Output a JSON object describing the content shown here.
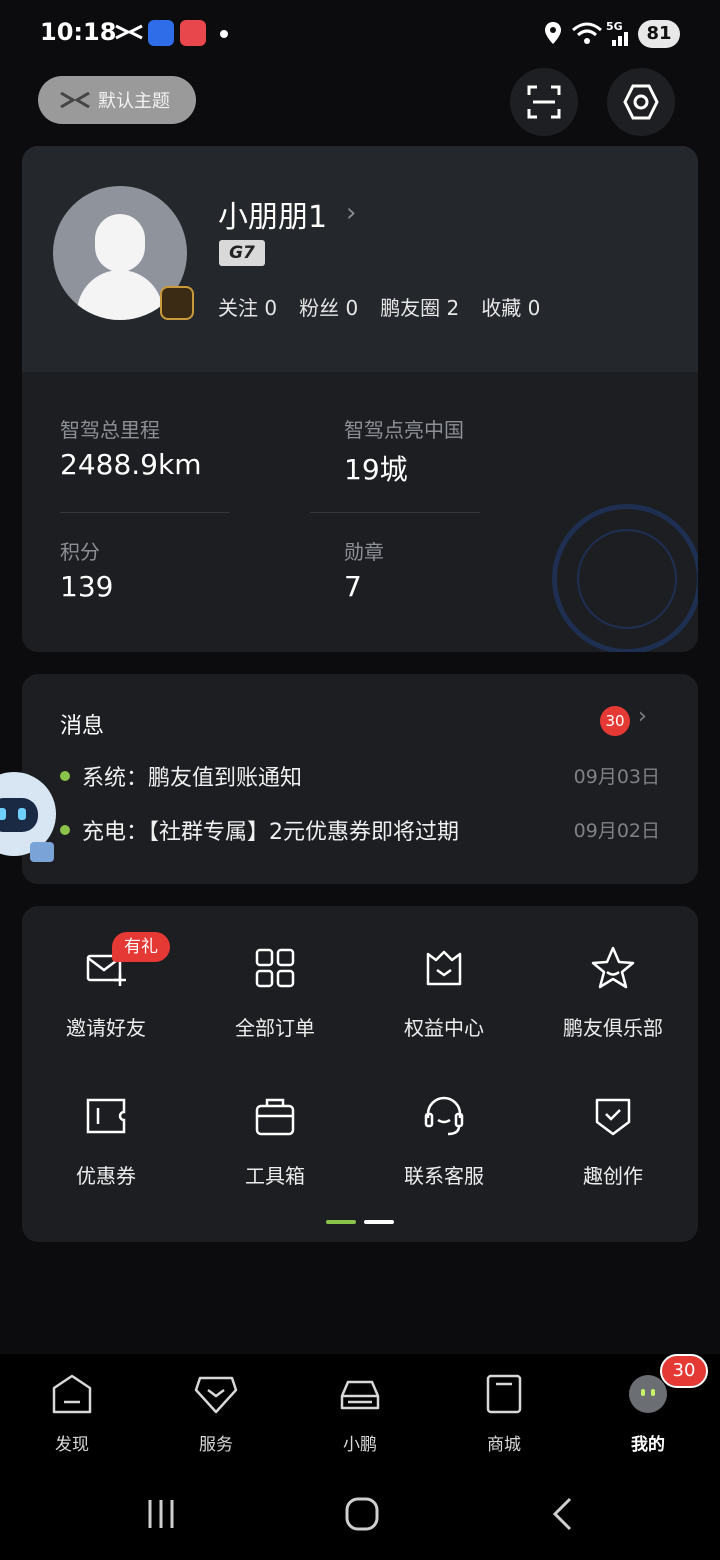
{
  "status_bar": {
    "time": "10:18",
    "battery": "81",
    "network": "5G"
  },
  "header": {
    "theme_label": "默认主题",
    "icons": [
      "scan-icon",
      "settings-icon"
    ]
  },
  "profile": {
    "username": "小朋朋1",
    "car_model": "G7",
    "social": [
      {
        "label": "关注",
        "value": "0"
      },
      {
        "label": "粉丝",
        "value": "0"
      },
      {
        "label": "鹏友圈",
        "value": "2"
      },
      {
        "label": "收藏",
        "value": "0"
      }
    ]
  },
  "stats": [
    {
      "label": "智驾总里程",
      "value": "2488.9km"
    },
    {
      "label": "智驾点亮中国",
      "value": "19城"
    },
    {
      "label": "积分",
      "value": "139"
    },
    {
      "label": "勋章",
      "value": "7"
    }
  ],
  "messages": {
    "title": "消息",
    "unread": "30",
    "items": [
      {
        "text": "系统：鹏友值到账通知",
        "date": "09月03日"
      },
      {
        "text": "充电：【社群专属】2元优惠券即将过期",
        "date": "09月02日"
      }
    ]
  },
  "services": {
    "gift_badge": "有礼",
    "items": [
      {
        "label": "邀请好友",
        "icon": "mail-plus-icon"
      },
      {
        "label": "全部订单",
        "icon": "grid-icon"
      },
      {
        "label": "权益中心",
        "icon": "crown-box-icon"
      },
      {
        "label": "鹏友俱乐部",
        "icon": "star-icon"
      },
      {
        "label": "优惠券",
        "icon": "coupon-icon"
      },
      {
        "label": "工具箱",
        "icon": "toolbox-icon"
      },
      {
        "label": "联系客服",
        "icon": "headset-icon"
      },
      {
        "label": "趣创作",
        "icon": "shield-check-icon"
      }
    ]
  },
  "bottom_nav": {
    "items": [
      {
        "label": "发现",
        "icon": "home-icon"
      },
      {
        "label": "服务",
        "icon": "diamond-icon"
      },
      {
        "label": "小鹏",
        "icon": "car-icon"
      },
      {
        "label": "商城",
        "icon": "bag-icon"
      },
      {
        "label": "我的",
        "icon": "profile-face-icon"
      }
    ],
    "active": "我的",
    "badge": "30"
  },
  "colors": {
    "background": "#0c0c0e",
    "card": "#1c1e22",
    "accent_green": "#8bc34a",
    "badge_red": "#e53935"
  }
}
